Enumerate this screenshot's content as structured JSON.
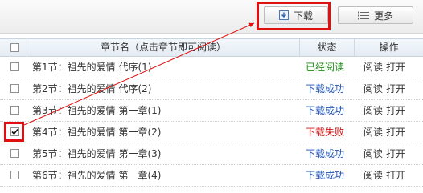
{
  "toolbar": {
    "download_label": "下载",
    "more_label": "更多",
    "download_icon": "download-icon",
    "more_icon": "list-icon"
  },
  "table": {
    "headers": [
      "章节名（点击章节即可阅读）",
      "状态",
      "操作"
    ],
    "rows": [
      {
        "name": "第1节：祖先的爱情 代序(1)",
        "status": "已经阅读",
        "status_type": "read",
        "checked": false,
        "ops": [
          "阅读",
          "打开"
        ]
      },
      {
        "name": "第2节：祖先的爱情 代序(2)",
        "status": "下载成功",
        "status_type": "ok",
        "checked": false,
        "ops": [
          "阅读",
          "打开"
        ]
      },
      {
        "name": "第3节：祖先的爱情 第一章(1)",
        "status": "下载成功",
        "status_type": "ok",
        "checked": false,
        "ops": [
          "阅读",
          "打开"
        ]
      },
      {
        "name": "第4节：祖先的爱情 第一章(2)",
        "status": "下载失败",
        "status_type": "fail",
        "checked": true,
        "ops": [
          "阅读",
          "打开"
        ]
      },
      {
        "name": "第5节：祖先的爱情 第一章(3)",
        "status": "下载成功",
        "status_type": "ok",
        "checked": false,
        "ops": [
          "阅读",
          "打开"
        ]
      },
      {
        "name": "第6节：祖先的爱情 第一章(4)",
        "status": "下载成功",
        "status_type": "ok",
        "checked": false,
        "ops": [
          "阅读",
          "打开"
        ]
      }
    ]
  },
  "colors": {
    "read": "#1a8a12",
    "ok": "#1e50b4",
    "fail": "#d01414",
    "annotation": "#e01010"
  }
}
